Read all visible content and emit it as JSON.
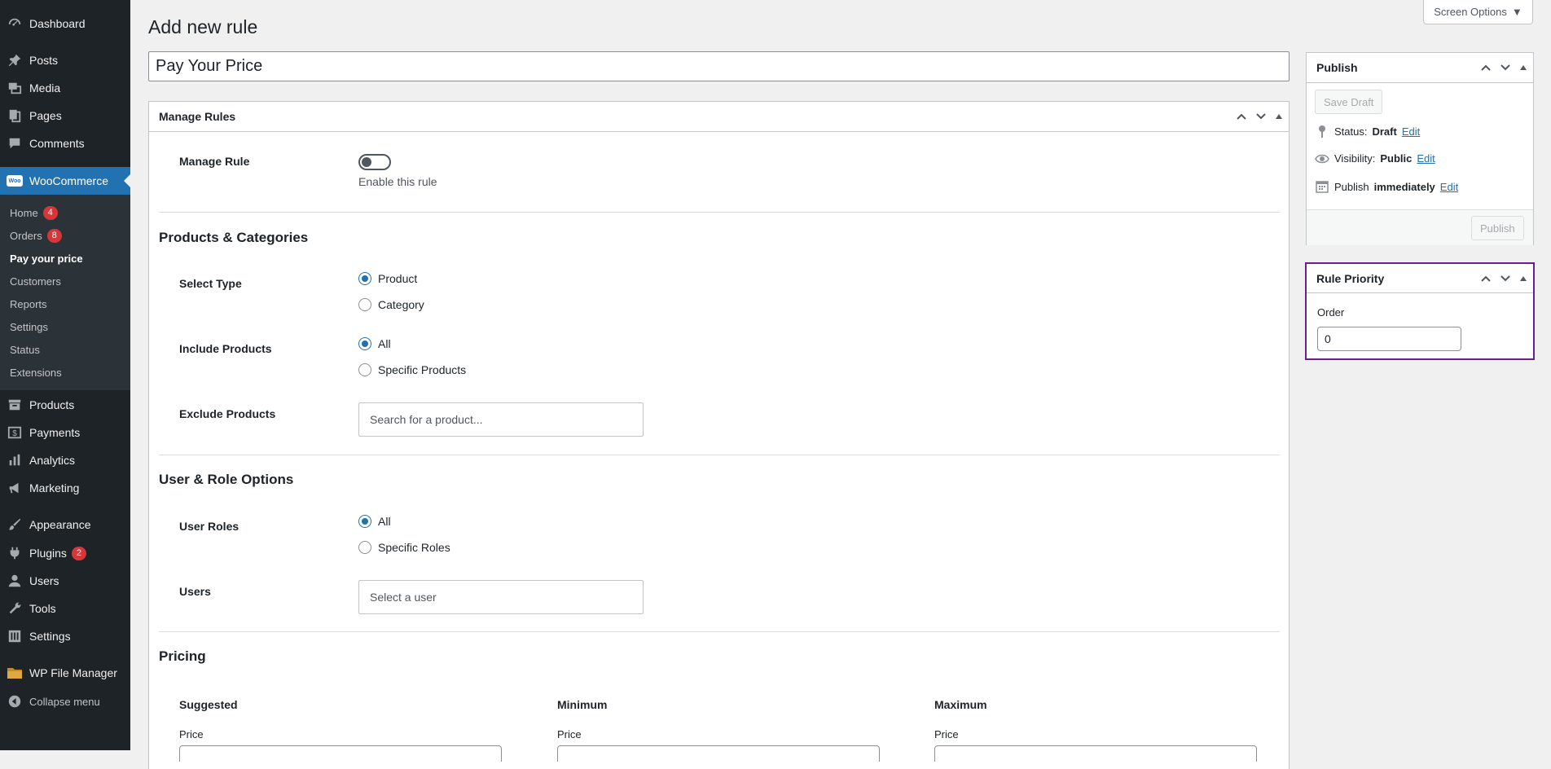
{
  "sidebar": {
    "items": [
      {
        "label": "Dashboard",
        "icon": "dashboard-icon"
      },
      {
        "label": "Posts",
        "icon": "pin-icon"
      },
      {
        "label": "Media",
        "icon": "media-icon"
      },
      {
        "label": "Pages",
        "icon": "pages-icon"
      },
      {
        "label": "Comments",
        "icon": "comment-icon"
      },
      {
        "label": "WooCommerce",
        "icon": "woocommerce-icon"
      },
      {
        "label": "Products",
        "icon": "archive-icon"
      },
      {
        "label": "Payments",
        "icon": "dollar-icon"
      },
      {
        "label": "Analytics",
        "icon": "bar-chart-icon"
      },
      {
        "label": "Marketing",
        "icon": "megaphone-icon"
      },
      {
        "label": "Appearance",
        "icon": "brush-icon"
      },
      {
        "label": "Plugins",
        "icon": "plug-icon",
        "badge": "2"
      },
      {
        "label": "Users",
        "icon": "user-icon"
      },
      {
        "label": "Tools",
        "icon": "wrench-icon"
      },
      {
        "label": "Settings",
        "icon": "settings-icon"
      },
      {
        "label": "WP File Manager",
        "icon": "folder-icon"
      },
      {
        "label": "Collapse menu",
        "icon": "collapse-icon"
      }
    ],
    "submenu": [
      {
        "label": "Home",
        "badge": "4"
      },
      {
        "label": "Orders",
        "badge": "8"
      },
      {
        "label": "Pay your price"
      },
      {
        "label": "Customers"
      },
      {
        "label": "Reports"
      },
      {
        "label": "Settings"
      },
      {
        "label": "Status"
      },
      {
        "label": "Extensions"
      }
    ]
  },
  "header": {
    "page_title": "Add new rule",
    "screen_options": "Screen Options"
  },
  "post_title": "Pay Your Price",
  "manage_rules": {
    "title": "Manage Rules",
    "manage_rule_label": "Manage Rule",
    "enable_text": "Enable this rule",
    "products_section": "Products & Categories",
    "select_type_label": "Select Type",
    "select_type_options": [
      "Product",
      "Category"
    ],
    "include_label": "Include Products",
    "include_options": [
      "All",
      "Specific Products"
    ],
    "exclude_label": "Exclude Products",
    "exclude_placeholder": "Search for a product...",
    "user_section": "User & Role Options",
    "user_roles_label": "User Roles",
    "user_roles_options": [
      "All",
      "Specific Roles"
    ],
    "users_label": "Users",
    "users_placeholder": "Select a user",
    "pricing_section": "Pricing",
    "pricing_columns": [
      {
        "heading": "Suggested",
        "price_label": "Price"
      },
      {
        "heading": "Minimum",
        "price_label": "Price"
      },
      {
        "heading": "Maximum",
        "price_label": "Price"
      }
    ]
  },
  "publish": {
    "title": "Publish",
    "save_draft": "Save Draft",
    "status_label": "Status:",
    "status_value": "Draft",
    "visibility_label": "Visibility:",
    "visibility_value": "Public",
    "publish_label": "Publish",
    "publish_value": "immediately",
    "edit": "Edit",
    "publish_button": "Publish"
  },
  "rule_priority": {
    "title": "Rule Priority",
    "order_label": "Order",
    "order_value": "0"
  }
}
